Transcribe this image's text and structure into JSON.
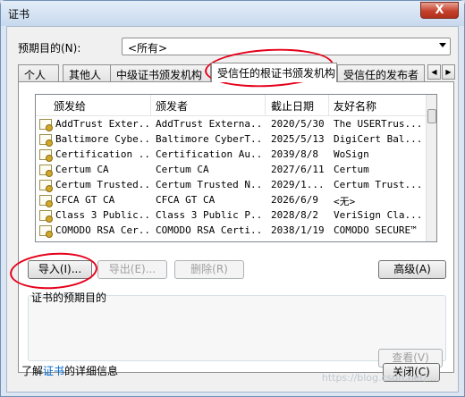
{
  "window": {
    "title": "证书",
    "close": "X"
  },
  "purpose": {
    "label": "预期目的(N):",
    "value": "<所有>"
  },
  "tabs": [
    "个人",
    "其他人",
    "中级证书颁发机构",
    "受信任的根证书颁发机构",
    "受信任的发布者"
  ],
  "tab_scroll": {
    "left": "◀",
    "right": "▶"
  },
  "columns": [
    "颁发给",
    "颁发者",
    "截止日期",
    "友好名称"
  ],
  "rows": [
    [
      "AddTrust Exter...",
      "AddTrust Externa...",
      "2020/5/30",
      "The USERTrus..."
    ],
    [
      "Baltimore Cybe...",
      "Baltimore CyberT...",
      "2025/5/13",
      "DigiCert Bal..."
    ],
    [
      "Certification ...",
      "Certification Au...",
      "2039/8/8",
      "WoSign"
    ],
    [
      "Certum CA",
      "Certum CA",
      "2027/6/11",
      "Certum"
    ],
    [
      "Certum Trusted...",
      "Certum Trusted N...",
      "2029/1...",
      "Certum Trust..."
    ],
    [
      "CFCA GT CA",
      "CFCA GT CA",
      "2026/6/9",
      "<无>"
    ],
    [
      "Class 3 Public...",
      "Class 3 Public P...",
      "2028/8/2",
      "VeriSign Cla..."
    ],
    [
      "COMODO RSA Cer...",
      "COMODO RSA Certi...",
      "2038/1/19",
      "COMODO SECURE™"
    ]
  ],
  "buttons": {
    "import": "导入(I)...",
    "export": "导出(E)...",
    "remove": "删除(R)",
    "advanced": "高级(A)",
    "view": "查看(V)",
    "close": "关闭(C)"
  },
  "group": {
    "label": "证书的预期目的"
  },
  "footer": {
    "prefix": "了解",
    "link": "证书",
    "suffix": "的详细信息"
  },
  "watermark": "https://blog.csdn.net/..."
}
